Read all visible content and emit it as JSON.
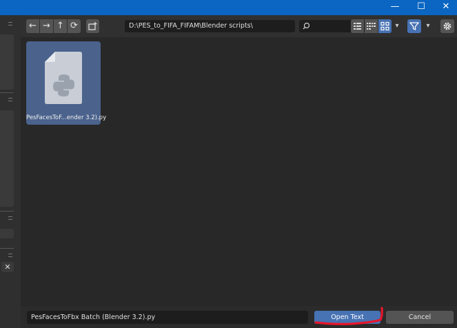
{
  "window": {
    "minimize_glyph": "—",
    "maximize_glyph": "☐",
    "close_glyph": "✕"
  },
  "toolbar": {
    "back_glyph": "←",
    "forward_glyph": "→",
    "parent_glyph": "↑",
    "refresh_glyph": "⟳",
    "path": "D:\\PES_to_FIFA_FIFAM\\Blender scripts\\",
    "search_placeholder": "",
    "view_mode_selected": "thumbnails",
    "filter_enabled": true
  },
  "files": [
    {
      "name": "PesFacesToF...ender 3.2).py",
      "type": "python",
      "selected": true
    }
  ],
  "bottom": {
    "filename_value": "PesFacesToFbx Batch (Blender 3.2).py",
    "open_label": "Open Text",
    "cancel_label": "Cancel"
  },
  "sidebar": {
    "close_glyph": "✕"
  },
  "colors": {
    "accent": "#4772b3",
    "titlebar": "#0a66c2",
    "annotation": "#e8162a"
  }
}
